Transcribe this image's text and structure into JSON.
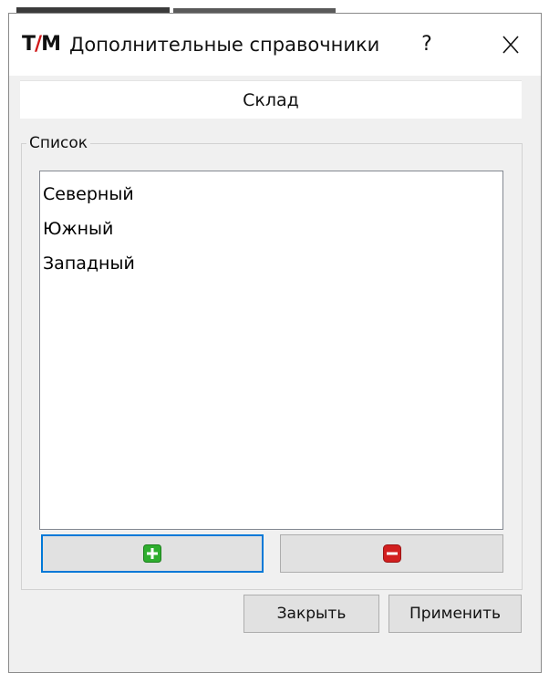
{
  "window": {
    "logo_left": "T",
    "logo_sep": "/",
    "logo_right": "M",
    "title": "Дополнительные справочники",
    "help_label": "?"
  },
  "tab": {
    "label": "Склад"
  },
  "group": {
    "title": "Список",
    "items": [
      "Северный",
      "Южный",
      "Западный"
    ]
  },
  "icons": {
    "add": "plus-green-icon",
    "remove": "minus-red-icon",
    "close": "close-icon"
  },
  "colors": {
    "add_icon": "#2fae2f",
    "remove_icon": "#d21f1f",
    "focus_border": "#0078d7",
    "logo_separator": "#d01818"
  },
  "buttons": {
    "close_label": "Закрыть",
    "apply_label": "Применить"
  }
}
